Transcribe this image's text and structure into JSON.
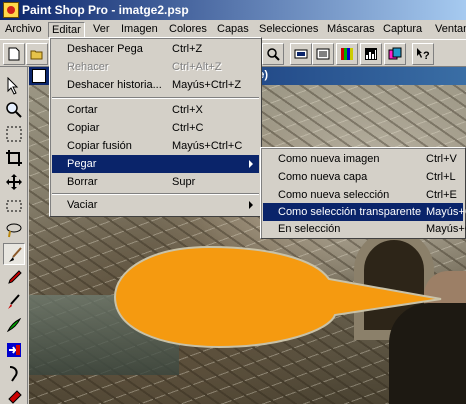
{
  "window": {
    "title": "Paint Shop Pro - imatge2.psp"
  },
  "menubar": {
    "items": [
      "Archivo",
      "Editar",
      "Ver",
      "Imagen",
      "Colores",
      "Capas",
      "Selecciones",
      "Máscaras",
      "Captura",
      "Ventan"
    ],
    "active": "Editar"
  },
  "document": {
    "title_fragment": "e)"
  },
  "edit_menu": {
    "items": [
      {
        "label": "Deshacer Pega",
        "shortcut": "Ctrl+Z",
        "enabled": true
      },
      {
        "label": "Rehacer",
        "shortcut": "Ctrl+Alt+Z",
        "enabled": false
      },
      {
        "label": "Deshacer historia...",
        "shortcut": "Mayús+Ctrl+Z",
        "enabled": true
      },
      {
        "label": "Cortar",
        "shortcut": "Ctrl+X",
        "enabled": true
      },
      {
        "label": "Copiar",
        "shortcut": "Ctrl+C",
        "enabled": true
      },
      {
        "label": "Copiar fusión",
        "shortcut": "Mayús+Ctrl+C",
        "enabled": true
      },
      {
        "label": "Pegar",
        "shortcut": "",
        "enabled": true,
        "submenu": true,
        "highlighted": true
      },
      {
        "label": "Borrar",
        "shortcut": "Supr",
        "enabled": true
      },
      {
        "label": "Vaciar",
        "shortcut": "",
        "enabled": true,
        "submenu": true
      }
    ]
  },
  "paste_submenu": {
    "items": [
      {
        "label": "Como nueva imagen",
        "shortcut": "Ctrl+V"
      },
      {
        "label": "Como nueva capa",
        "shortcut": "Ctrl+L"
      },
      {
        "label": "Como nueva selección",
        "shortcut": "Ctrl+E"
      },
      {
        "label": "Como selección transparente",
        "shortcut": "Mayús+C",
        "highlighted": true
      },
      {
        "label": "En selección",
        "shortcut": "Mayús+C"
      }
    ]
  },
  "toolbar": {
    "icons": [
      "new-icon",
      "open-icon",
      "zoom-icon",
      "histogram-icon",
      "layer-palette-icon",
      "color-balance-icon",
      "chart-icon",
      "overview-icon",
      "help-icon"
    ]
  },
  "tools": {
    "icons": [
      "arrow-tool-icon",
      "zoom-tool-icon",
      "selection-tool-icon",
      "crop-tool-icon",
      "mover-tool-icon",
      "selection-rect-icon",
      "lasso-tool-icon",
      "eyedropper-tool-icon",
      "paintbrush-tool-icon",
      "clone-tool-icon",
      "color-replacer-icon",
      "retouch-tool-icon",
      "scratch-remover-icon",
      "eraser-tool-icon",
      "flood-fill-tool-icon"
    ]
  },
  "colors": {
    "title_gradient_start": "#0a246a",
    "title_gradient_end": "#a6caf0",
    "highlight": "#0a246a",
    "balloon_fill": "#f59a10",
    "balloon_stroke": "#c9c2a8"
  }
}
